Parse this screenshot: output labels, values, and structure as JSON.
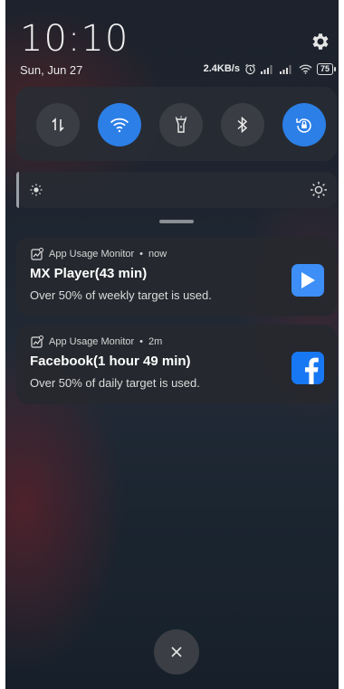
{
  "status": {
    "time": "10:10",
    "date": "Sun, Jun 27",
    "net_speed": "2.4KB/s",
    "battery": "75"
  },
  "quick_settings": [
    {
      "id": "data",
      "icon": "mobile-data-icon",
      "on": false
    },
    {
      "id": "wifi",
      "icon": "wifi-icon",
      "on": true
    },
    {
      "id": "flashlight",
      "icon": "flashlight-icon",
      "on": false
    },
    {
      "id": "bluetooth",
      "icon": "bluetooth-icon",
      "on": false
    },
    {
      "id": "rotation",
      "icon": "rotation-lock-icon",
      "on": true
    }
  ],
  "colors": {
    "accent": "#2c7fe6",
    "mx_player": "#3d8ef7",
    "facebook": "#1877f2"
  },
  "notifications": [
    {
      "app": "App Usage Monitor",
      "time": "now",
      "title": "MX Player(43 min)",
      "body": "Over 50% of weekly target is used.",
      "icon": "mx-player-icon"
    },
    {
      "app": "App Usage Monitor",
      "time": "2m",
      "title": "Facebook(1 hour 49 min)",
      "body": "Over 50% of daily target is used.",
      "icon": "facebook-icon"
    }
  ],
  "separator": "•"
}
